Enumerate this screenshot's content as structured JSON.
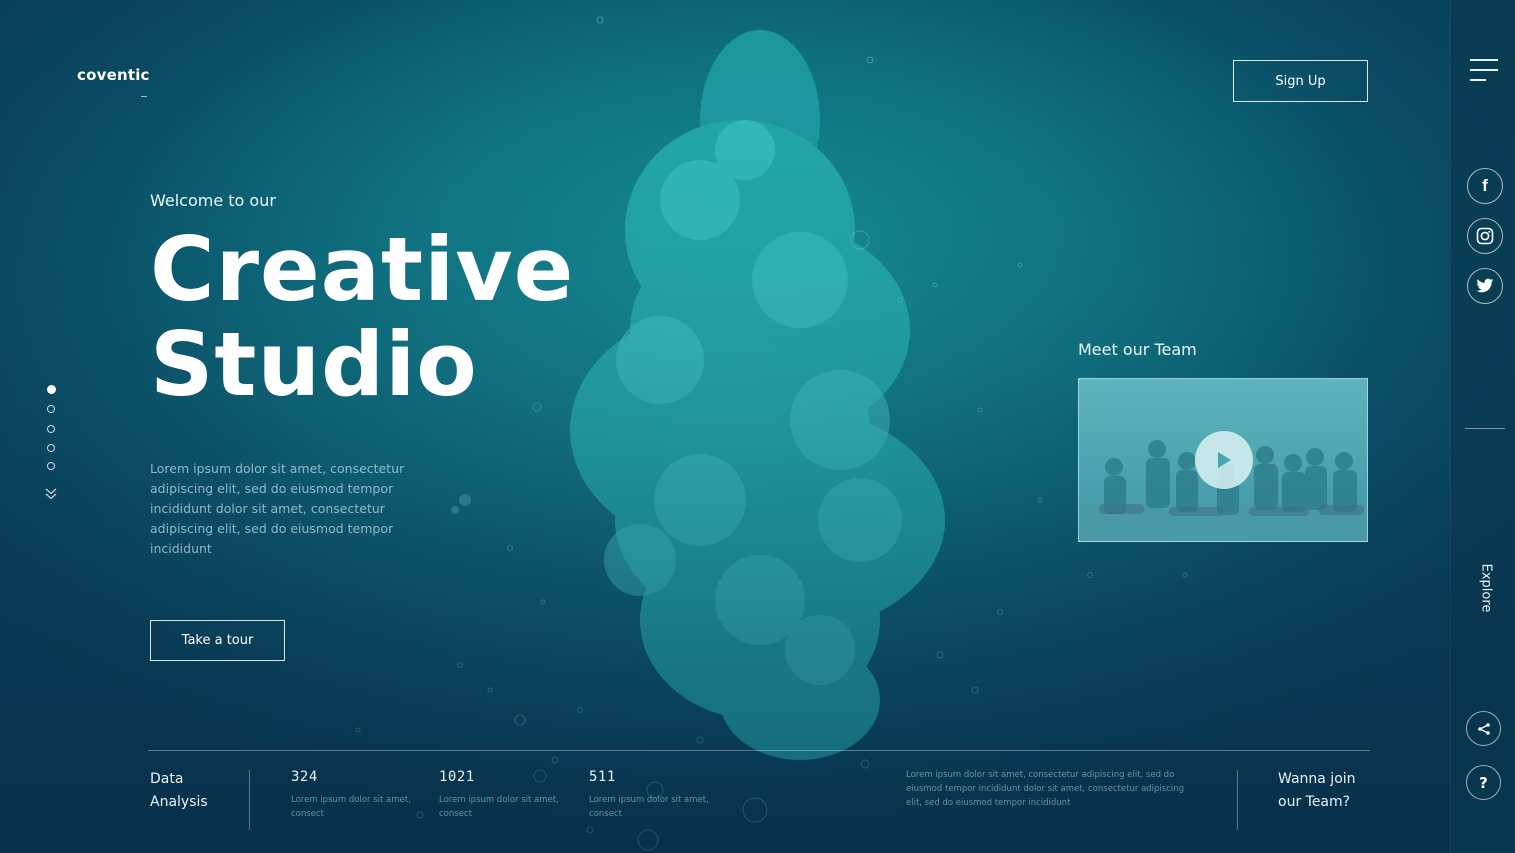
{
  "brand": {
    "logo_text": "coventic"
  },
  "header": {
    "signup_label": "Sign Up"
  },
  "hero": {
    "welcome": "Welcome to our",
    "title_line1": "Creative",
    "title_line2": "Studio",
    "description": "Lorem ipsum dolor sit amet, consectetur adipiscing elit, sed do eiusmod tempor incididunt dolor sit amet, consectetur adipiscing elit, sed do eiusmod tempor incididunt",
    "cta_label": "Take a tour"
  },
  "pagination": {
    "total": 5,
    "active_index": 0
  },
  "team": {
    "heading": "Meet our Team"
  },
  "sidebar": {
    "socials": [
      {
        "icon": "facebook-icon",
        "glyph": "f"
      },
      {
        "icon": "instagram-icon"
      },
      {
        "icon": "twitter-icon"
      }
    ],
    "explore_label": "Explore",
    "help_glyph": "?"
  },
  "footer": {
    "label_line1": "Data",
    "label_line2": "Analysis",
    "stats": [
      {
        "value": "324",
        "desc": "Lorem ipsum dolor sit amet, consect"
      },
      {
        "value": "1021",
        "desc": "Lorem ipsum dolor sit amet, consect"
      },
      {
        "value": "511",
        "desc": "Lorem ipsum dolor sit amet, consect"
      }
    ],
    "paragraph": "Lorem ipsum dolor sit amet, consectetur adipiscing elit, sed do eiusmod tempor incididunt dolor sit amet, consectetur adipiscing elit, sed do eiusmod tempor incididunt",
    "join_line1": "Wanna join",
    "join_line2": "our Team?"
  },
  "colors": {
    "background": "#0a5a6e",
    "sidebar": "#08344a",
    "ink_cloud": "#2bb8b8",
    "text": "#ffffff"
  }
}
